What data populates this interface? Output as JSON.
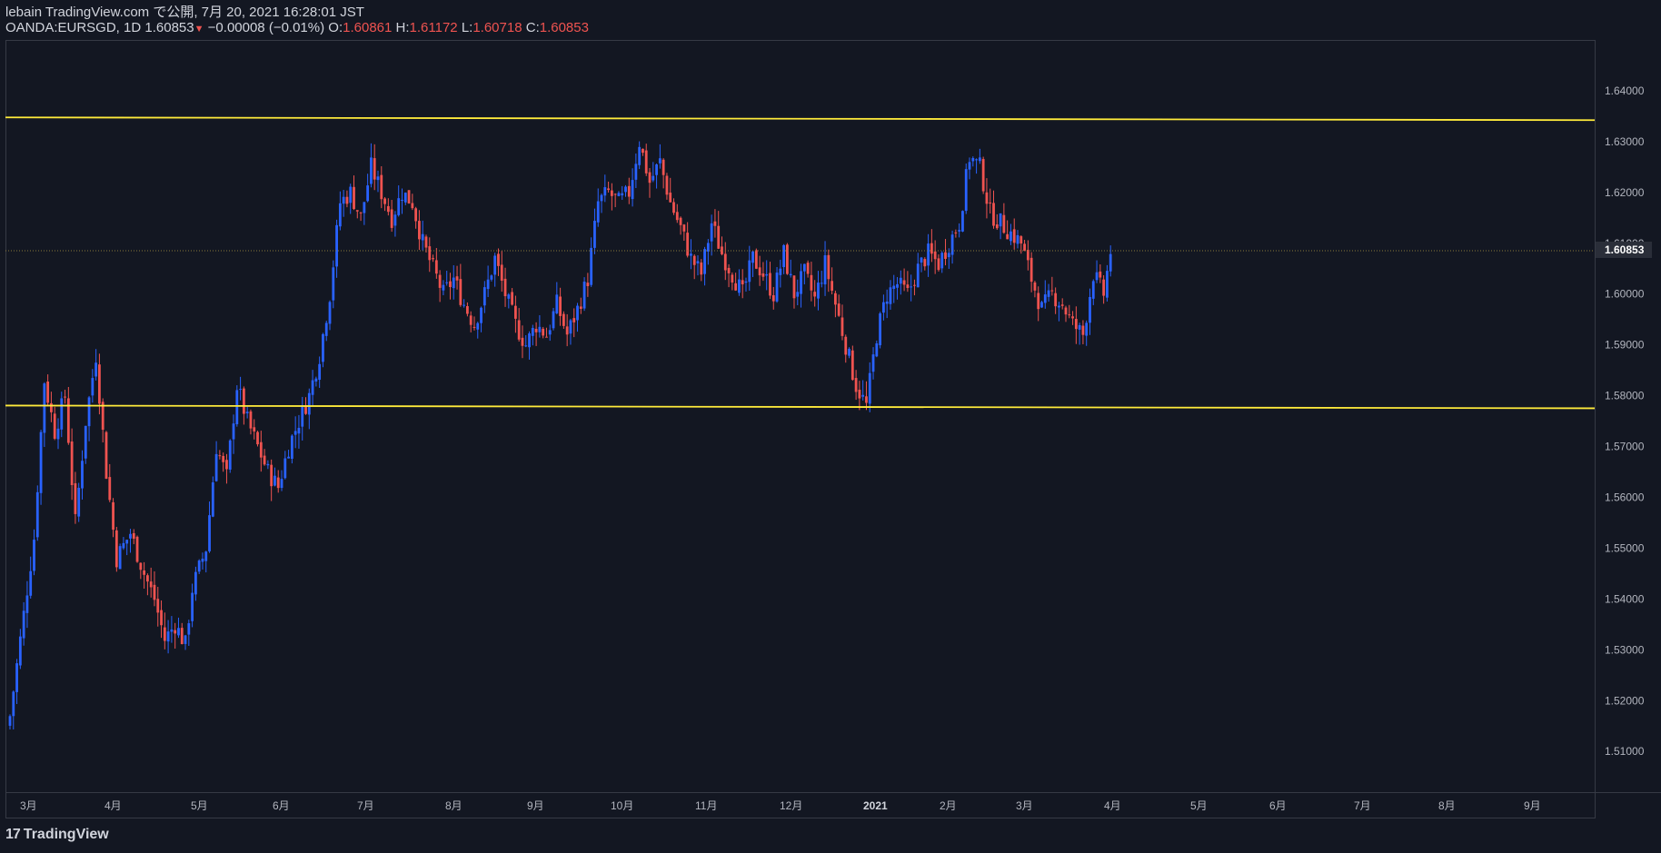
{
  "header": {
    "publish": "lebain TradingView.com で公開, 7月 20, 2021 16:28:01 JST",
    "symbol": "OANDA:EURSGD, 1D",
    "last": "1.60853",
    "change_arrow": "▼",
    "change": "−0.00008 (−0.01%)",
    "o_label": "O:",
    "o": "1.60861",
    "h_label": "H:",
    "h": "1.61172",
    "l_label": "L:",
    "l": "1.60718",
    "c_label": "C:",
    "c": "1.60853"
  },
  "brand": {
    "logo_mark": "17",
    "name": "TradingView"
  },
  "colors": {
    "background": "#131722",
    "up": "#2962ff",
    "down": "#ef5350",
    "level_line": "#ffeb3b",
    "axis_text": "#b2b5be",
    "border": "#363a45"
  },
  "chart_data": {
    "type": "candlestick",
    "symbol": "OANDA:EURSGD",
    "timeframe": "1D",
    "ylim": [
      1.502,
      1.65
    ],
    "y_ticks": [
      "1.51000",
      "1.52000",
      "1.53000",
      "1.54000",
      "1.55000",
      "1.56000",
      "1.57000",
      "1.58000",
      "1.59000",
      "1.60000",
      "1.61000",
      "1.62000",
      "1.63000",
      "1.64000"
    ],
    "x_ticks": [
      "3月",
      "4月",
      "5月",
      "6月",
      "7月",
      "8月",
      "9月",
      "10月",
      "11月",
      "12月",
      "2021",
      "2月",
      "3月",
      "4月",
      "5月",
      "6月",
      "7月",
      "8月",
      "9月"
    ],
    "last_price_label": "1.60853",
    "last_price": 1.60853,
    "horizontal_levels": [
      1.6345,
      1.5778
    ],
    "close_path": [
      [
        0,
        1.517
      ],
      [
        3,
        1.532
      ],
      [
        7,
        1.552
      ],
      [
        10,
        1.583
      ],
      [
        13,
        1.573
      ],
      [
        16,
        1.58
      ],
      [
        19,
        1.555
      ],
      [
        22,
        1.575
      ],
      [
        25,
        1.588
      ],
      [
        28,
        1.565
      ],
      [
        31,
        1.548
      ],
      [
        35,
        1.553
      ],
      [
        39,
        1.545
      ],
      [
        42,
        1.54
      ],
      [
        45,
        1.532
      ],
      [
        48,
        1.535
      ],
      [
        51,
        1.531
      ],
      [
        53,
        1.542
      ],
      [
        57,
        1.55
      ],
      [
        60,
        1.57
      ],
      [
        63,
        1.564
      ],
      [
        66,
        1.582
      ],
      [
        69,
        1.575
      ],
      [
        72,
        1.57
      ],
      [
        75,
        1.565
      ],
      [
        78,
        1.562
      ],
      [
        81,
        1.57
      ],
      [
        84,
        1.575
      ],
      [
        87,
        1.58
      ],
      [
        90,
        1.588
      ],
      [
        93,
        1.6
      ],
      [
        96,
        1.618
      ],
      [
        99,
        1.62
      ],
      [
        102,
        1.615
      ],
      [
        105,
        1.625
      ],
      [
        108,
        1.62
      ],
      [
        111,
        1.615
      ],
      [
        114,
        1.62
      ],
      [
        117,
        1.618
      ],
      [
        120,
        1.61
      ],
      [
        123,
        1.605
      ],
      [
        126,
        1.6
      ],
      [
        129,
        1.603
      ],
      [
        132,
        1.598
      ],
      [
        135,
        1.594
      ],
      [
        138,
        1.6
      ],
      [
        141,
        1.607
      ],
      [
        144,
        1.6
      ],
      [
        147,
        1.594
      ],
      [
        150,
        1.59
      ],
      [
        153,
        1.594
      ],
      [
        156,
        1.592
      ],
      [
        159,
        1.598
      ],
      [
        162,
        1.592
      ],
      [
        165,
        1.597
      ],
      [
        168,
        1.603
      ],
      [
        171,
        1.618
      ],
      [
        174,
        1.62
      ],
      [
        177,
        1.618
      ],
      [
        180,
        1.62
      ],
      [
        183,
        1.63
      ],
      [
        186,
        1.622
      ],
      [
        189,
        1.626
      ],
      [
        192,
        1.618
      ],
      [
        195,
        1.613
      ],
      [
        198,
        1.607
      ],
      [
        201,
        1.604
      ],
      [
        204,
        1.614
      ],
      [
        207,
        1.608
      ],
      [
        210,
        1.604
      ],
      [
        213,
        1.6
      ],
      [
        216,
        1.607
      ],
      [
        219,
        1.604
      ],
      [
        222,
        1.6
      ],
      [
        225,
        1.608
      ],
      [
        228,
        1.6
      ],
      [
        231,
        1.604
      ],
      [
        234,
        1.599
      ],
      [
        237,
        1.606
      ],
      [
        240,
        1.598
      ],
      [
        243,
        1.59
      ],
      [
        246,
        1.582
      ],
      [
        249,
        1.578
      ],
      [
        252,
        1.592
      ],
      [
        255,
        1.6
      ],
      [
        258,
        1.602
      ],
      [
        261,
        1.6
      ],
      [
        264,
        1.605
      ],
      [
        267,
        1.608
      ],
      [
        270,
        1.606
      ],
      [
        273,
        1.61
      ],
      [
        276,
        1.614
      ],
      [
        279,
        1.627
      ],
      [
        282,
        1.625
      ],
      [
        285,
        1.616
      ],
      [
        288,
        1.614
      ],
      [
        291,
        1.612
      ],
      [
        294,
        1.61
      ],
      [
        297,
        1.603
      ],
      [
        300,
        1.597
      ],
      [
        303,
        1.6
      ],
      [
        306,
        1.598
      ],
      [
        309,
        1.594
      ],
      [
        312,
        1.592
      ],
      [
        315,
        1.604
      ],
      [
        318,
        1.6
      ],
      [
        320,
        1.6085
      ]
    ],
    "n_bars": 321
  }
}
